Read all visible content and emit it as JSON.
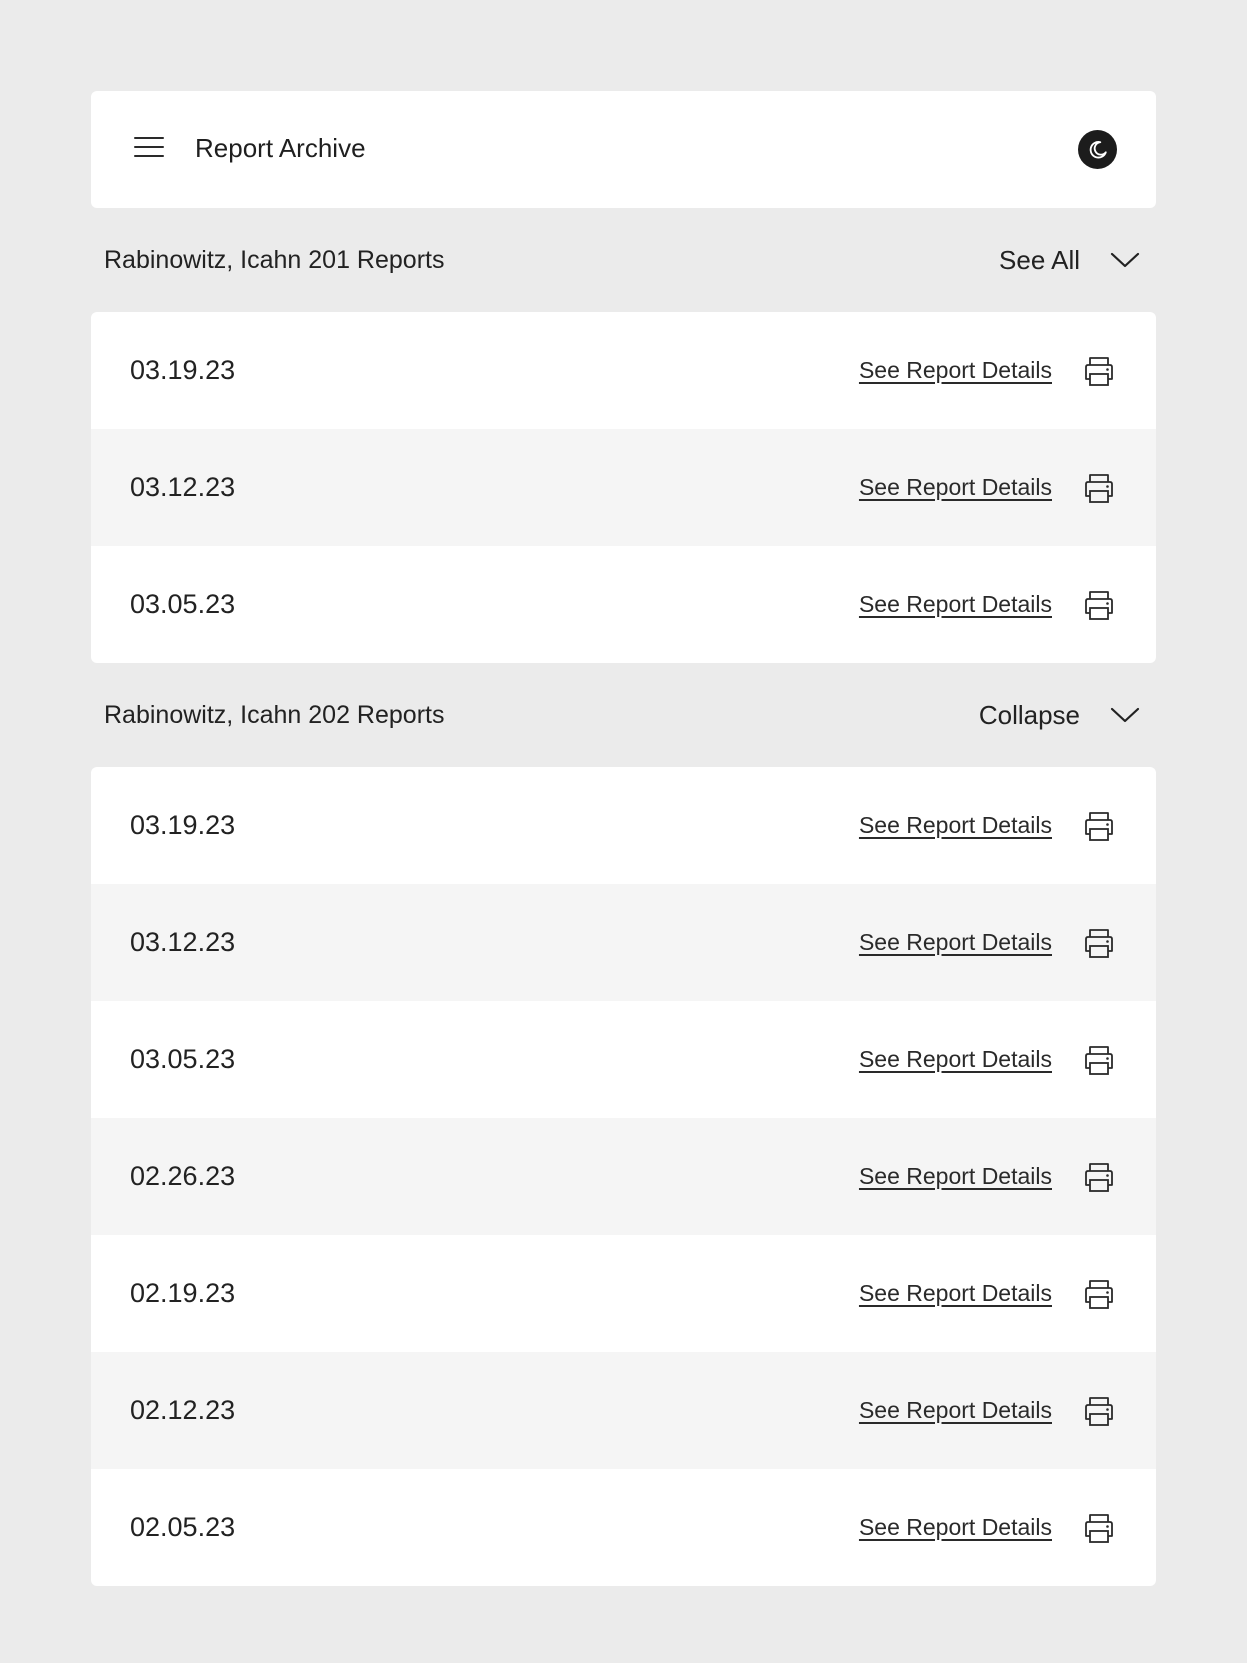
{
  "header": {
    "title": "Report Archive",
    "menu_icon": "hamburger-menu-icon",
    "theme_icon": "moon-icon"
  },
  "sections": [
    {
      "title": "Rabinowitz, Icahn 201 Reports",
      "toggle_label": "See All",
      "toggle_icon": "chevron-down-icon",
      "rows": [
        {
          "date": "03.19.23",
          "link": "See Report Details"
        },
        {
          "date": "03.12.23",
          "link": "See Report Details"
        },
        {
          "date": "03.05.23",
          "link": "See Report Details"
        }
      ]
    },
    {
      "title": "Rabinowitz, Icahn 202 Reports",
      "toggle_label": "Collapse",
      "toggle_icon": "chevron-down-icon",
      "rows": [
        {
          "date": "03.19.23",
          "link": "See Report Details"
        },
        {
          "date": "03.12.23",
          "link": "See Report Details"
        },
        {
          "date": "03.05.23",
          "link": "See Report Details"
        },
        {
          "date": "02.26.23",
          "link": "See Report Details"
        },
        {
          "date": "02.19.23",
          "link": "See Report Details"
        },
        {
          "date": "02.12.23",
          "link": "See Report Details"
        },
        {
          "date": "02.05.23",
          "link": "See Report Details"
        }
      ]
    }
  ],
  "colors": {
    "background": "#ebebeb",
    "card": "#ffffff",
    "row_alt": "#f5f5f5",
    "text": "#222222"
  }
}
